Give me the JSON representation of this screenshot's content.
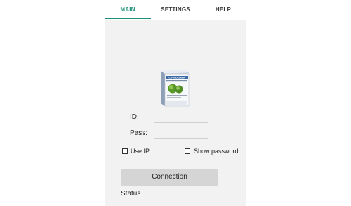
{
  "tabs": [
    {
      "label": "MAIN",
      "active": true
    },
    {
      "label": "SETTINGS",
      "active": false
    },
    {
      "label": "HELP",
      "active": false
    }
  ],
  "logo": {
    "icon": "product-box-icon",
    "text": "CITONDESKER"
  },
  "form": {
    "id_label": "ID:",
    "id_value": "",
    "pass_label": "Pass:",
    "pass_value": ""
  },
  "options": {
    "use_ip_label": "Use IP",
    "use_ip_checked": false,
    "show_password_label": "Show password",
    "show_password_checked": false
  },
  "connection_button_label": "Connection",
  "status_label": "Status",
  "colors": {
    "accent": "#1e8f78",
    "button": "#d5d5d5",
    "panel": "#f2f2f2"
  }
}
